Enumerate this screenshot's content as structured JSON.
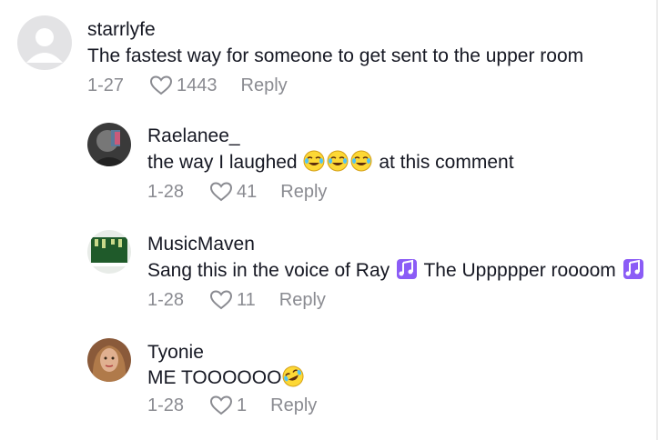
{
  "comments": [
    {
      "username": "starrlyfe",
      "text": "The fastest way for someone to get sent to the upper room",
      "date": "1-27",
      "likes": "1443",
      "reply_label": "Reply"
    },
    {
      "username": "Raelanee_",
      "text_before": "the way I laughed",
      "emoji": "laughing-tears-emoji",
      "text_after": " at this comment",
      "date": "1-28",
      "likes": "41",
      "reply_label": "Reply"
    },
    {
      "username": "MusicMaven",
      "text_before": "Sang this in the voice of Ray",
      "emoji": "music-notes-emoji",
      "text_middle": " The Uppppper roooom",
      "date": "1-28",
      "likes": "11",
      "reply_label": "Reply"
    },
    {
      "username": "Tyonie",
      "text": "ME TOOOOOO",
      "emoji": "rolling-laughing-emoji",
      "date": "1-28",
      "likes": "1",
      "reply_label": "Reply"
    }
  ],
  "colors": {
    "primary_text": "#161823",
    "secondary_text": "#8a8b91",
    "emoji_purple": "#7b4fd6"
  }
}
